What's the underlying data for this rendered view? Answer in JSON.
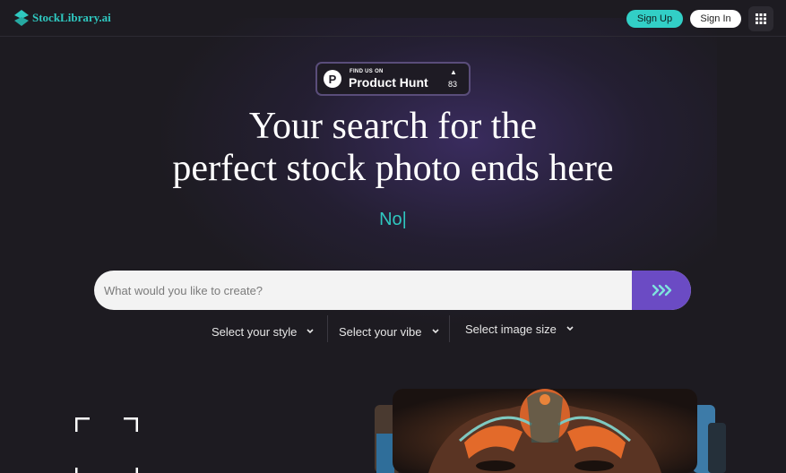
{
  "header": {
    "logo_text": "StockLibrary.ai",
    "signup_label": "Sign Up",
    "signin_label": "Sign In",
    "apps_icon": "grid-icon"
  },
  "product_hunt": {
    "small_label": "FIND US ON",
    "big_label": "Product Hunt",
    "logo_letter": "P",
    "arrow": "▲",
    "votes": "83"
  },
  "hero": {
    "line1": "Your search for the",
    "line2": "perfect stock photo ends here",
    "typing_text": "No|"
  },
  "search": {
    "placeholder": "What would you like to create?",
    "value": "",
    "submit_icon": "double-chevron-right-icon"
  },
  "filters": [
    {
      "label": "Select your style"
    },
    {
      "label": "Select your vibe"
    },
    {
      "label": "Select image size"
    }
  ],
  "colors": {
    "accent_teal": "#32cfc6",
    "accent_purple": "#6b4bc4",
    "background": "#1d1b21"
  }
}
